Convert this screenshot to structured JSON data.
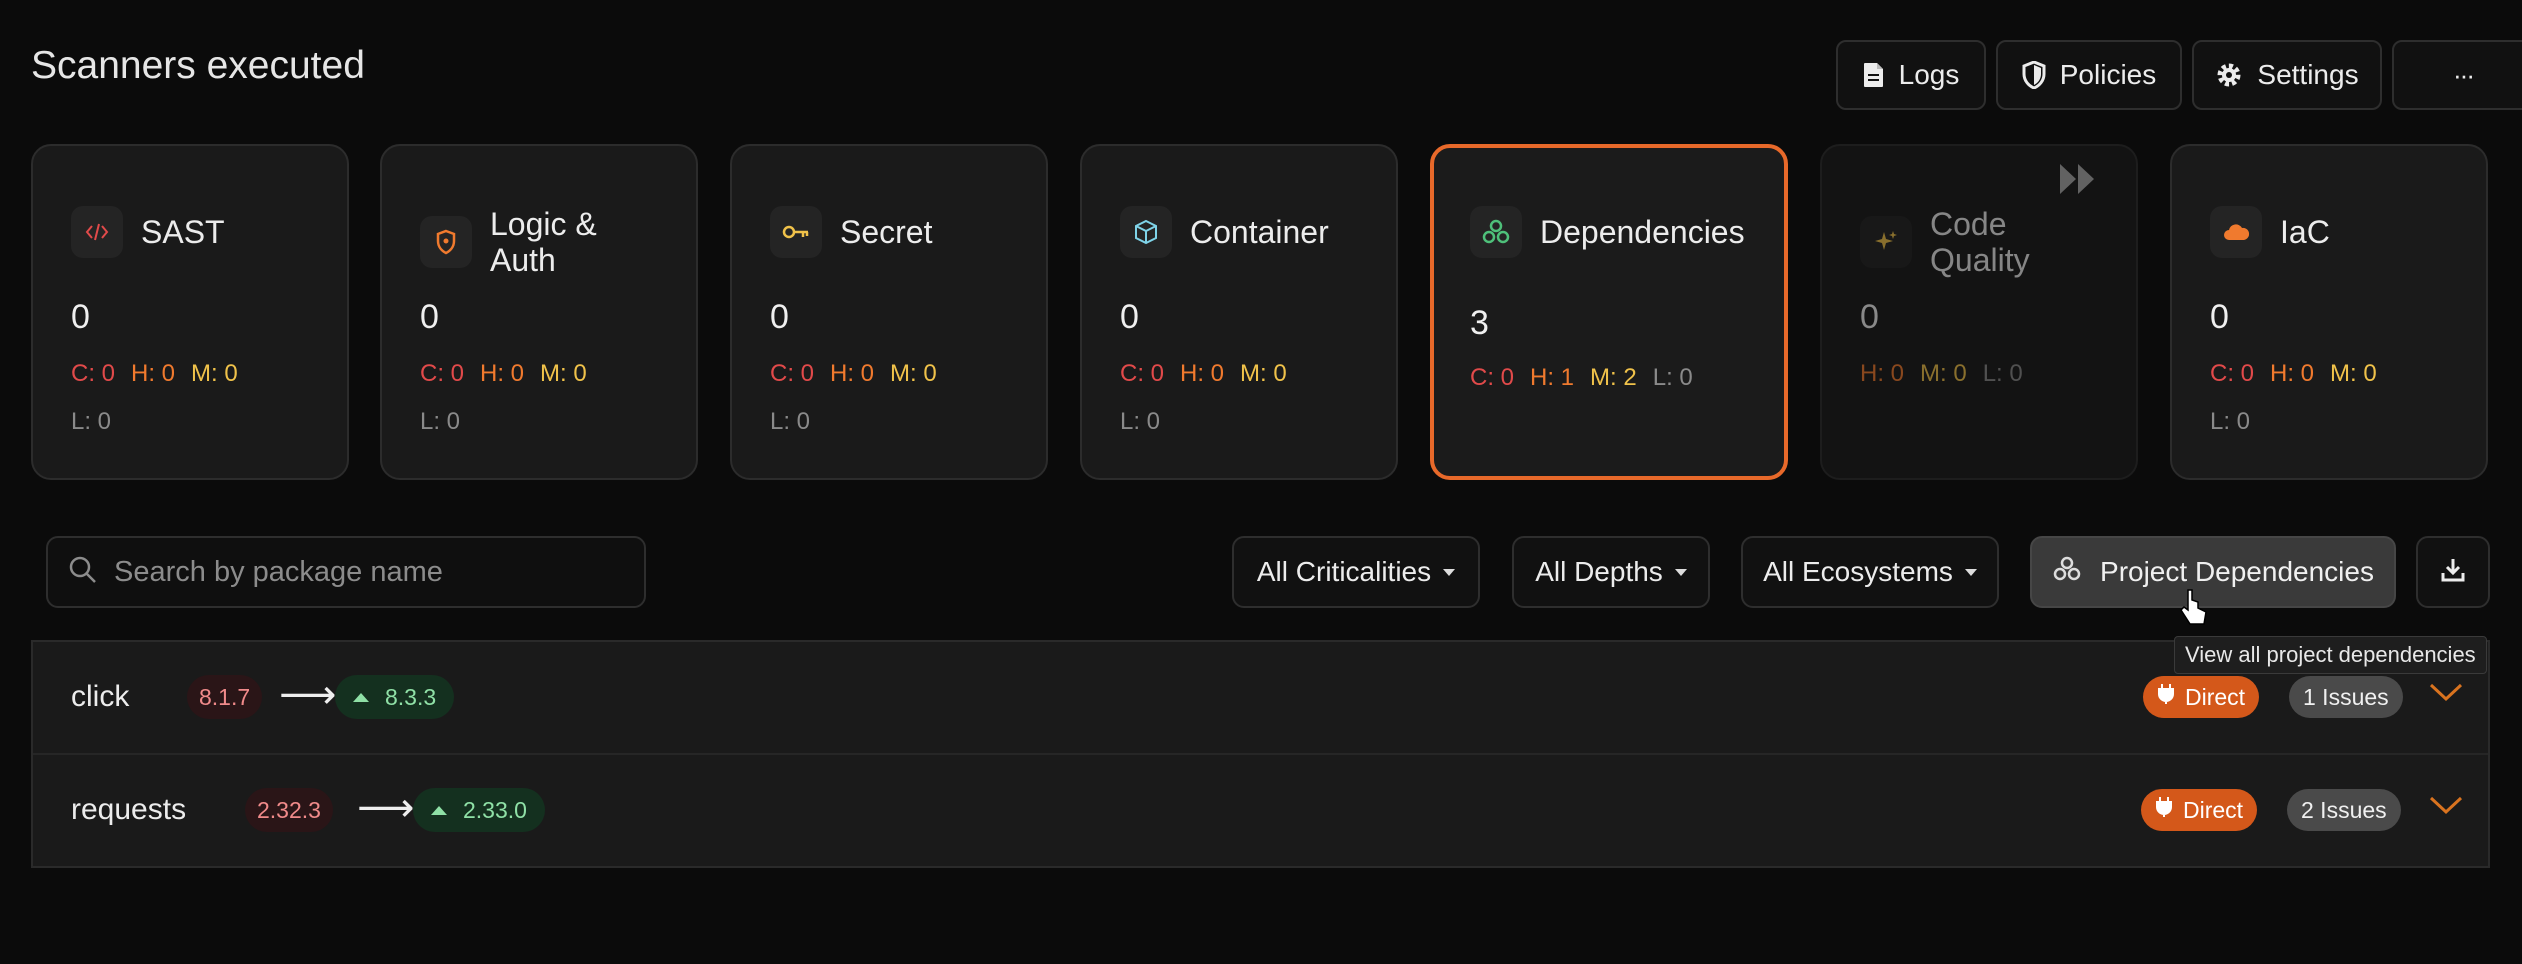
{
  "header": {
    "title": "Scanners executed"
  },
  "toolbar": {
    "logs_label": "Logs",
    "policies_label": "Policies",
    "settings_label": "Settings",
    "more_label": "···"
  },
  "scanners": [
    {
      "label": "SAST",
      "icon": "code-icon",
      "count": "0",
      "c": "C: 0",
      "h": "H: 0",
      "m": "M: 0",
      "l": "L: 0"
    },
    {
      "label": "Logic &\nAuth",
      "icon": "shield-icon",
      "count": "0",
      "c": "C: 0",
      "h": "H: 0",
      "m": "M: 0",
      "l": "L: 0"
    },
    {
      "label": "Secret",
      "icon": "key-icon",
      "count": "0",
      "c": "C: 0",
      "h": "H: 0",
      "m": "M: 0",
      "l": "L: 0"
    },
    {
      "label": "Container",
      "icon": "box-icon",
      "count": "0",
      "c": "C: 0",
      "h": "H: 0",
      "m": "M: 0",
      "l": "L: 0"
    },
    {
      "label": "Dependencies",
      "icon": "dependencies-icon",
      "count": "3",
      "c": "C: 0",
      "h": "H: 1",
      "m": "M: 2",
      "l": "L: 0"
    },
    {
      "label": "Code\nQuality",
      "icon": "sparkle-icon",
      "count": "0",
      "h": "H: 0",
      "m": "M: 0",
      "l": "L: 0"
    },
    {
      "label": "IaC",
      "icon": "cloud-icon",
      "count": "0",
      "c": "C: 0",
      "h": "H: 0",
      "m": "M: 0",
      "l": "L: 0"
    }
  ],
  "filters": {
    "search_placeholder": "Search by package name",
    "criticality": "All Criticalities",
    "depth": "All Depths",
    "ecosystem": "All Ecosystems",
    "project_dependencies": "Project Dependencies",
    "tooltip": "View all project dependencies"
  },
  "packages": [
    {
      "name": "click",
      "current": "8.1.7",
      "latest": "8.3.3",
      "type": "Direct",
      "issues": "1 Issues"
    },
    {
      "name": "requests",
      "current": "2.32.3",
      "latest": "2.33.0",
      "type": "Direct",
      "issues": "2 Issues"
    }
  ],
  "colors": {
    "accent": "#e8692a",
    "critical": "#e14a4a",
    "high": "#f07a2e",
    "medium": "#f0c24a",
    "low": "#8a8a8a"
  }
}
